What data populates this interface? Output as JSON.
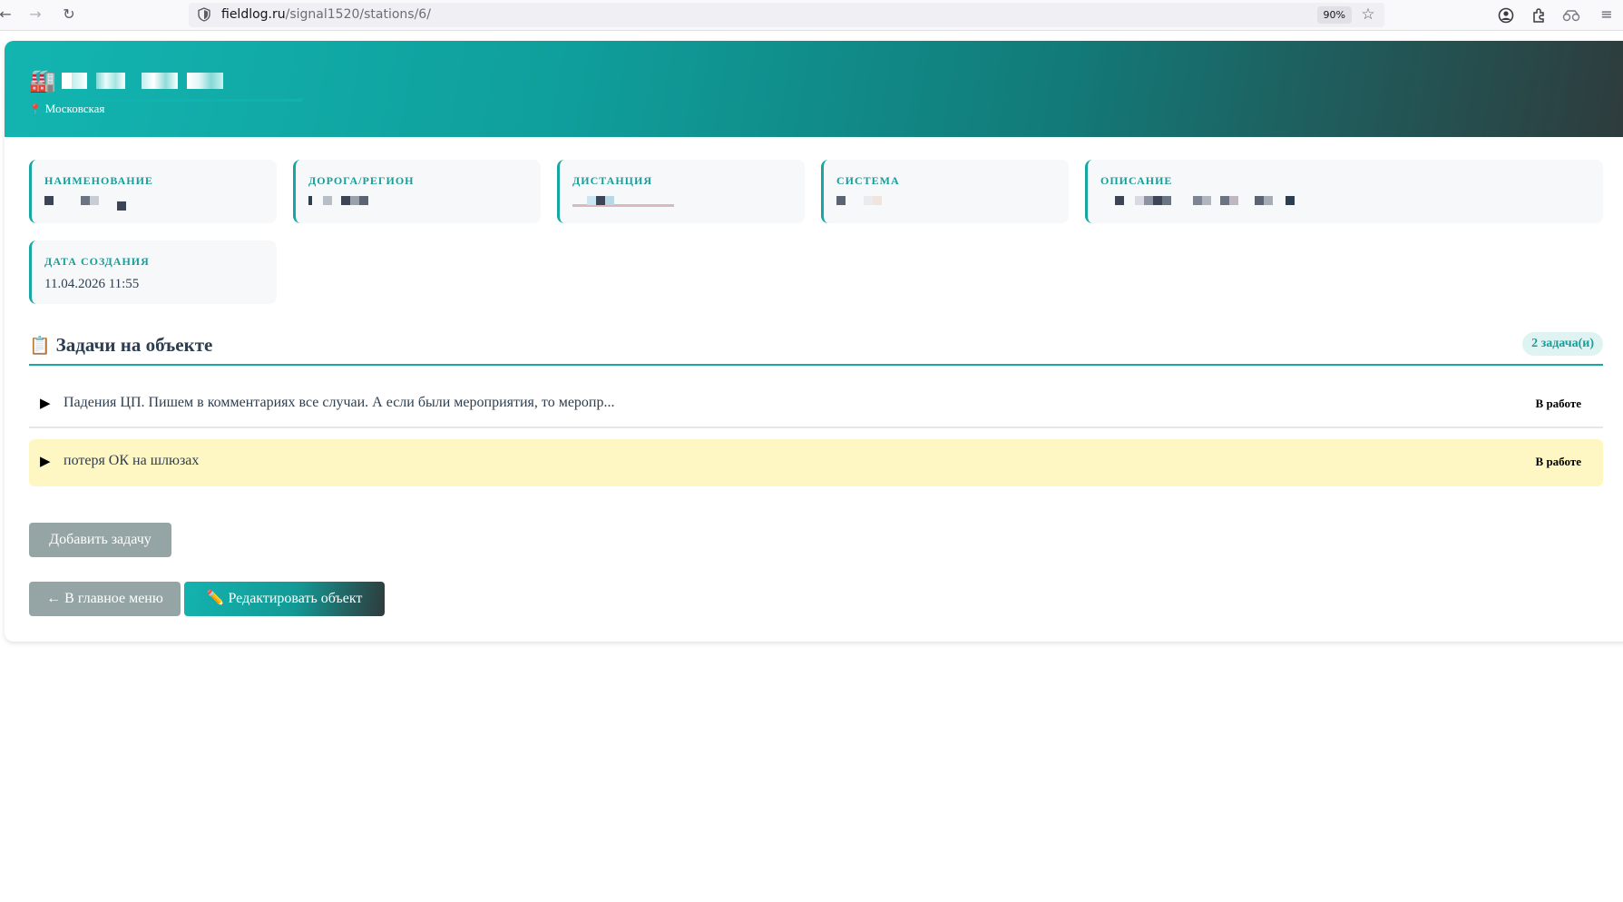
{
  "browser": {
    "url_host": "fieldlog.ru",
    "url_path": "/signal1520/stations/6/",
    "zoom": "90%"
  },
  "station": {
    "location": "Московская"
  },
  "fields": {
    "name_label": "НАИМЕНОВАНИЕ",
    "road_label": "ДОРОГА/РЕГИОН",
    "distance_label": "ДИСТАНЦИЯ",
    "system_label": "СИСТЕМА",
    "description_label": "ОПИСАНИЕ",
    "created_label": "ДАТА СОЗДАНИЯ",
    "created_value": "11.04.2026 11:55"
  },
  "tasks": {
    "title": "Задачи на объекте",
    "count_badge": "2 задача(и)",
    "items": [
      {
        "text": "Падения ЦП. Пишем в комментариях все случаи. А если были мероприятия, то меропр...",
        "status": "В работе"
      },
      {
        "text": "потеря ОК на шлюзах",
        "status": "В работе"
      }
    ],
    "add_button": "Добавить задачу"
  },
  "actions": {
    "back_button": "← В главное меню",
    "edit_button": "✏️ Редактировать объект"
  },
  "colors": {
    "accent": "#17a7a3",
    "highlight_row": "#fff7c3",
    "muted_button": "#95a5a6"
  }
}
